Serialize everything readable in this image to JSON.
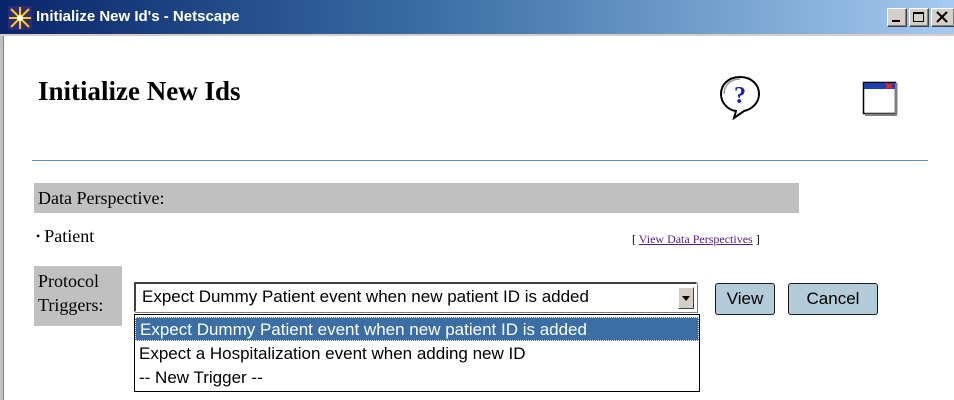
{
  "window": {
    "title": "Initialize New Id's - Netscape",
    "app_icon": "netscape-icon",
    "controls": {
      "minimize_icon": "minimize-icon",
      "maximize_icon": "maximize-icon",
      "close_icon": "close-icon"
    }
  },
  "page": {
    "title": "Initialize New Ids",
    "help_icon": "help-icon",
    "close_window_icon": "close-window-icon"
  },
  "data_perspective": {
    "header": "Data Perspective:",
    "item": "Patient",
    "link_open": "[",
    "link_text": "View Data Perspectives",
    "link_close": "]"
  },
  "protocol_triggers": {
    "label_line1": "Protocol",
    "label_line2": "Triggers:",
    "selected_value": "Expect Dummy Patient event when new patient ID is added",
    "options": [
      "Expect Dummy Patient event when new patient ID is added",
      "Expect a Hospitalization event when adding new ID",
      "-- New Trigger --"
    ],
    "highlighted_index": 0,
    "view_button": "View",
    "cancel_button": "Cancel"
  },
  "colors": {
    "titlebar_start": "#0a246a",
    "titlebar_end": "#a6caf0",
    "section_header_bg": "#c0c0c0",
    "button_bg": "#b4cbd9",
    "selection_bg": "#3a6ea5",
    "divider": "#5a8fb8"
  }
}
